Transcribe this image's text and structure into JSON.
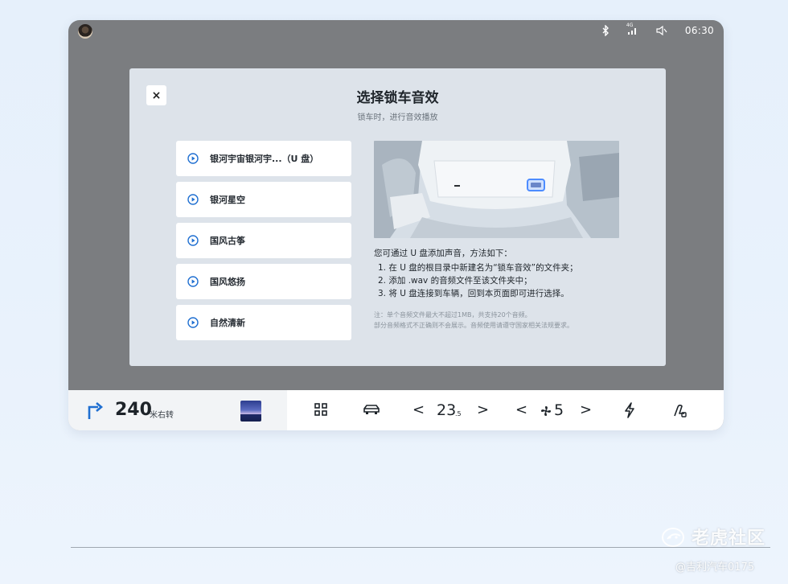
{
  "status_bar": {
    "time": "06:30",
    "signal_label": "4G"
  },
  "dialog": {
    "title": "选择锁车音效",
    "subtitle": "锁车时，进行音效播放",
    "close_symbol": "×",
    "sounds": [
      {
        "label": "银河宇宙银河宇...（U 盘）"
      },
      {
        "label": "银河星空"
      },
      {
        "label": "国风古筝"
      },
      {
        "label": "国风悠扬"
      },
      {
        "label": "自然清新"
      }
    ],
    "instructions": {
      "title": "您可通过 U 盘添加声音，方法如下：",
      "steps": [
        "1. 在 U 盘的根目录中新建名为“锁车音效”的文件夹；",
        "2. 添加 .wav 的音频文件至该文件夹中；",
        "3. 将 U 盘连接到车辆，回到本页面即可进行选择。"
      ],
      "notes": [
        "注：单个音频文件最大不超过1MB，共支持20个音频。",
        "部分音频格式不正确则不会展示。音频使用请遵守国家相关法规要求。"
      ]
    }
  },
  "taskbar": {
    "nav_distance": "240",
    "nav_unit": "米右转",
    "temperature_main": "23",
    "temperature_decimal": ".5",
    "fan_level": "5",
    "prev_symbol": "<",
    "next_symbol": ">"
  },
  "watermark": {
    "site": "老虎社区",
    "credit": "@吉利汽车0175"
  },
  "colors": {
    "screen_bg": "#7b7d80",
    "dialog_bg": "#dde3ea",
    "accent_blue": "#1f6fd1"
  }
}
